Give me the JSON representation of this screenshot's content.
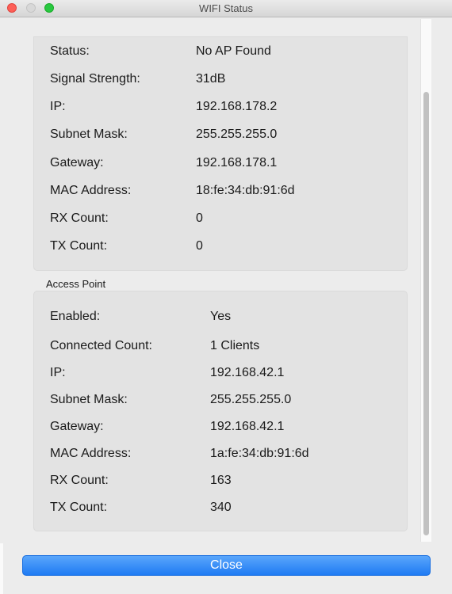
{
  "window": {
    "title": "WIFI Status"
  },
  "station": {
    "rows": [
      {
        "label": "Status:",
        "value": "No AP Found"
      },
      {
        "label": "Signal Strength:",
        "value": "31dB"
      },
      {
        "label": "IP:",
        "value": "192.168.178.2"
      },
      {
        "label": "Subnet Mask:",
        "value": "255.255.255.0"
      },
      {
        "label": "Gateway:",
        "value": "192.168.178.1"
      },
      {
        "label": "MAC Address:",
        "value": "18:fe:34:db:91:6d"
      },
      {
        "label": "RX Count:",
        "value": "0"
      },
      {
        "label": "TX Count:",
        "value": "0"
      }
    ]
  },
  "access_point": {
    "title": "Access Point",
    "rows": [
      {
        "label": "Enabled:",
        "value": "Yes"
      },
      {
        "label": "Connected Count:",
        "value": "1 Clients"
      },
      {
        "label": "IP:",
        "value": "192.168.42.1"
      },
      {
        "label": "Subnet Mask:",
        "value": "255.255.255.0"
      },
      {
        "label": "Gateway:",
        "value": "192.168.42.1"
      },
      {
        "label": "MAC Address:",
        "value": "1a:fe:34:db:91:6d"
      },
      {
        "label": "RX Count:",
        "value": "163"
      },
      {
        "label": "TX Count:",
        "value": "340"
      }
    ]
  },
  "buttons": {
    "close_label": "Close"
  },
  "colors": {
    "accent": "#1f7bf3",
    "close_dot": "#fd5f57",
    "zoom_dot": "#28c840"
  }
}
